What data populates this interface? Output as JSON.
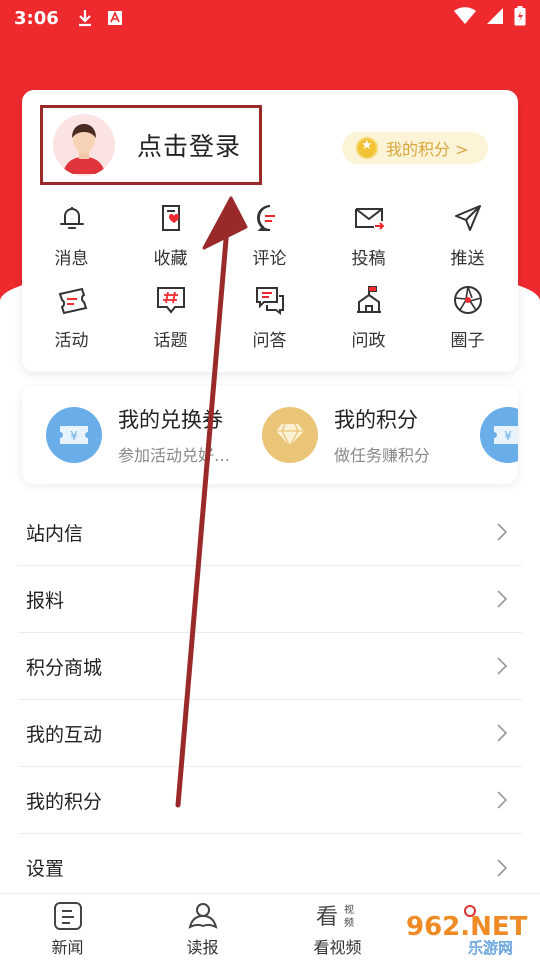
{
  "status_bar": {
    "time": "3:06"
  },
  "profile": {
    "login_text": "点击登录",
    "points_label": "我的积分 >"
  },
  "quick_grid": [
    [
      {
        "label": "消息",
        "icon": "bell-icon"
      },
      {
        "label": "收藏",
        "icon": "favorite-icon"
      },
      {
        "label": "评论",
        "icon": "comment-icon"
      },
      {
        "label": "投稿",
        "icon": "mail-icon"
      },
      {
        "label": "推送",
        "icon": "send-icon"
      }
    ],
    [
      {
        "label": "活动",
        "icon": "ticket-icon"
      },
      {
        "label": "话题",
        "icon": "topic-icon"
      },
      {
        "label": "问答",
        "icon": "qa-icon"
      },
      {
        "label": "问政",
        "icon": "government-icon"
      },
      {
        "label": "圈子",
        "icon": "aperture-icon"
      }
    ]
  ],
  "coupons": [
    {
      "title": "我的兑换券",
      "subtitle": "参加活动兑好…",
      "icon": "coupon-icon",
      "color": "#6aaee9"
    },
    {
      "title": "我的积分",
      "subtitle": "做任务赚积分",
      "icon": "diamond-icon",
      "color": "#ebc577"
    }
  ],
  "menu": [
    {
      "label": "站内信"
    },
    {
      "label": "报料"
    },
    {
      "label": "积分商城"
    },
    {
      "label": "我的互动"
    },
    {
      "label": "我的积分"
    },
    {
      "label": "设置"
    }
  ],
  "bottom_nav": [
    {
      "label": "新闻",
      "icon": "news-icon"
    },
    {
      "label": "读报",
      "icon": "read-icon"
    },
    {
      "label": "看视频",
      "icon": "video-icon"
    }
  ],
  "watermark": {
    "text": "962.NET",
    "subtext": "乐游网"
  },
  "colors": {
    "accent_red": "#ee2a2f",
    "annotation": "#9a2a2a"
  }
}
